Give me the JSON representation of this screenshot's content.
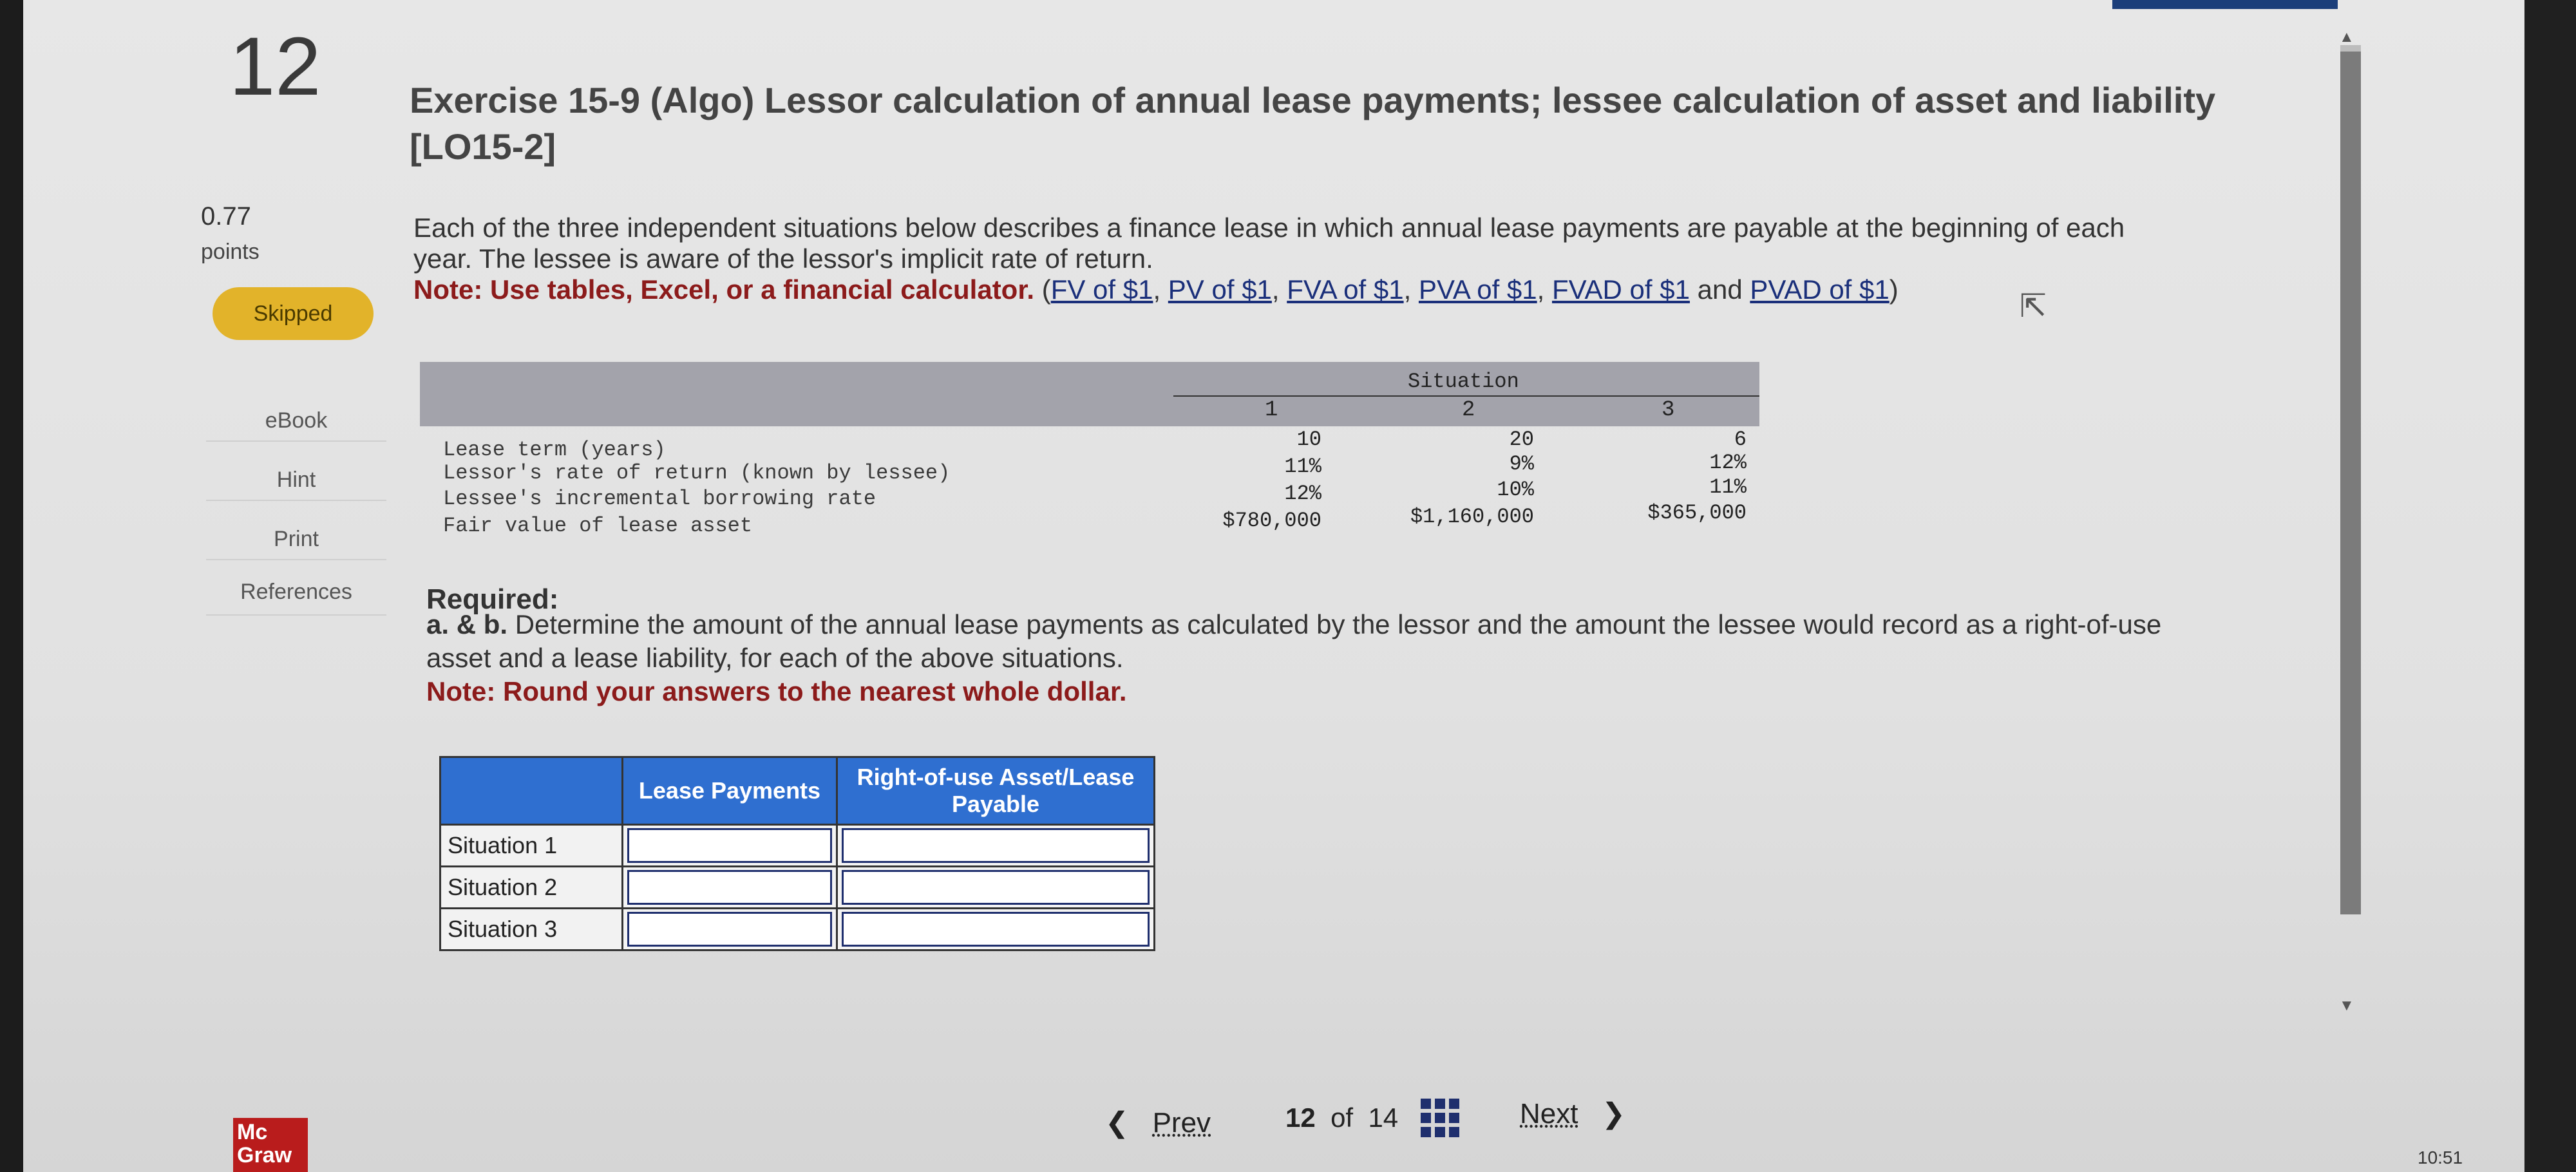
{
  "question_number": "12",
  "points": {
    "value": "0.77",
    "label": "points"
  },
  "status_badge": "Skipped",
  "side_nav": [
    "eBook",
    "Hint",
    "Print",
    "References"
  ],
  "title": "Exercise 15-9 (Algo) Lessor calculation of annual lease payments; lessee calculation of asset and liability [LO15-2]",
  "intro": {
    "text": "Each of the three independent situations below describes a finance lease in which annual lease payments are payable at the beginning of each year. The lessee is aware of the lessor's implicit rate of return.",
    "note": "Note: Use tables, Excel, or a financial calculator.",
    "links": [
      "FV of $1",
      "PV of $1",
      "FVA of $1",
      "PVA of $1",
      "FVAD of $1",
      "PVAD of $1"
    ],
    "and_word": "and"
  },
  "given_table": {
    "header": "Situation",
    "columns": [
      "1",
      "2",
      "3"
    ],
    "rows": [
      {
        "label": "Lease term (years)",
        "values": [
          "10",
          "20",
          "6"
        ]
      },
      {
        "label": "Lessor's rate of return (known by lessee)",
        "values": [
          "11%",
          "9%",
          "12%"
        ]
      },
      {
        "label": "Lessee's incremental borrowing rate",
        "values": [
          "12%",
          "10%",
          "11%"
        ]
      },
      {
        "label": "Fair value of lease asset",
        "values": [
          "$780,000",
          "$1,160,000",
          "$365,000"
        ]
      }
    ]
  },
  "required": {
    "heading": "Required:",
    "ab": "a. & b.",
    "text": "Determine the amount of the annual lease payments as calculated by the lessor and the amount the lessee would record as a right-of-use asset and a lease liability, for each of the above situations.",
    "note": "Note: Round your answers to the nearest whole dollar."
  },
  "answer_table": {
    "headers": [
      "",
      "Lease Payments",
      "Right-of-use Asset/Lease Payable"
    ],
    "rows": [
      "Situation 1",
      "Situation 2",
      "Situation 3"
    ]
  },
  "footer": {
    "logo": [
      "Mc",
      "Graw"
    ],
    "prev": "Prev",
    "page_current": "12",
    "page_of": "of",
    "page_total": "14",
    "next": "Next"
  },
  "clock": "10:51"
}
